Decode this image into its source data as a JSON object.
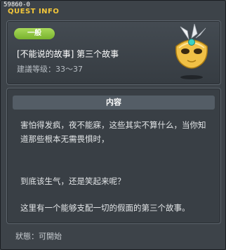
{
  "quest_id": "59860-0",
  "window_title": "QUEST INFO",
  "category_badge": "一般",
  "quest_title": "[不能说的故事] 第三个故事",
  "level_range": "建議等级：33～37",
  "section_header": "内容",
  "description": {
    "paragraph1": "害怕得发疯，夜不能寐，这些其实不算什么，当你知道那些根本无需畏惧时，",
    "paragraph2": "到底该生气，还是笑起来呢？",
    "paragraph3": "这里有一个能够支配一切的假面的第三个故事。"
  },
  "status": "狀態：可開始",
  "icons": {
    "quest_icon": "golden-masquerade-mask-icon"
  },
  "colors": {
    "window_title": "#f3c73a",
    "badge": "#8cc63f",
    "panel_bg": "#3d4349",
    "section_header_bg": "#545d66"
  }
}
